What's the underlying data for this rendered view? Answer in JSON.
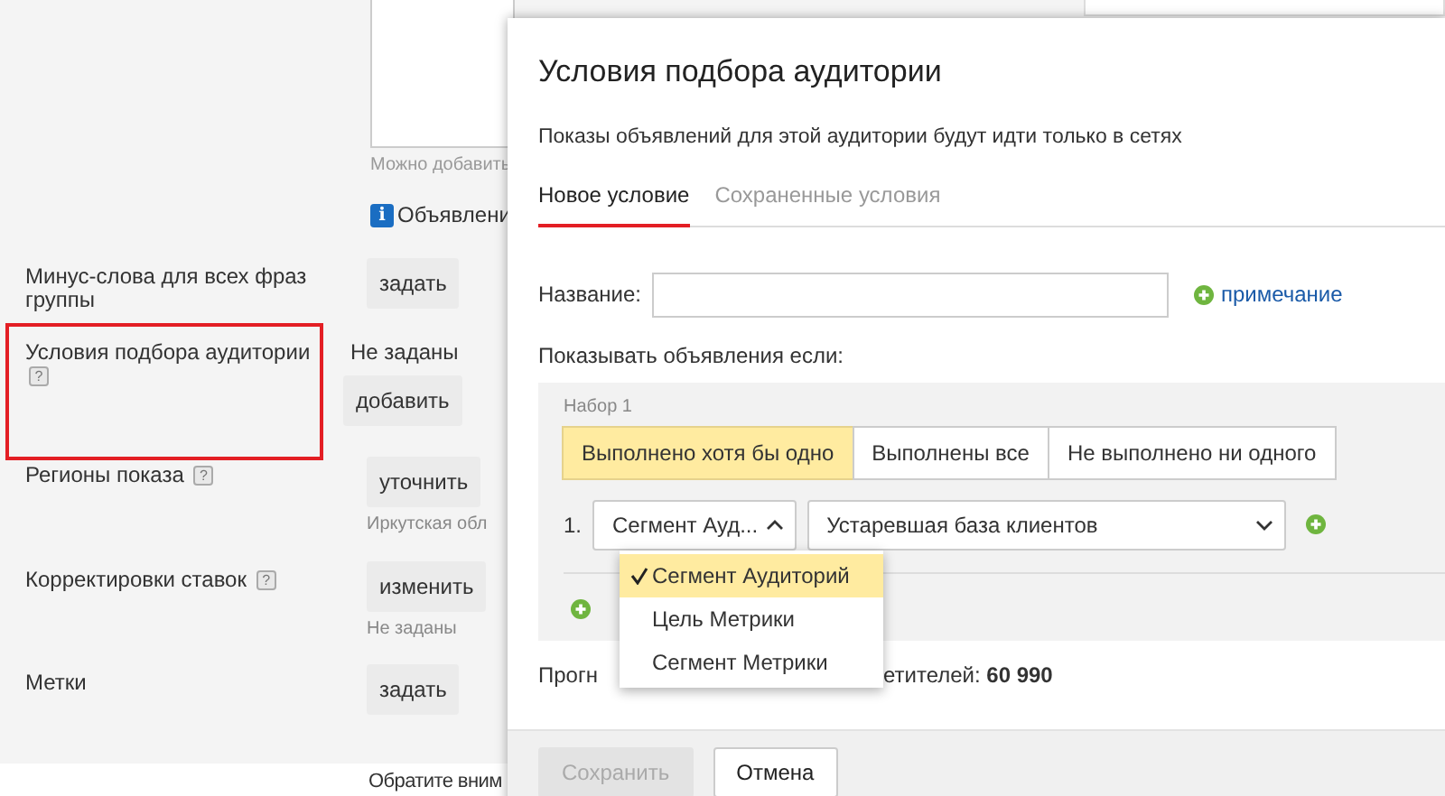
{
  "page": {
    "textarea_hint": "Можно добавить",
    "info": {
      "icon": "i",
      "text": "Объявлени"
    },
    "fields": [
      {
        "label": "Минус-слова для всех фраз группы",
        "button": "задать"
      },
      {
        "label": "Условия подбора аудитории",
        "help": "?",
        "highlighted": true,
        "value": "Не заданы",
        "button": "добавить"
      },
      {
        "label": "Регионы показа",
        "help": "?",
        "button": "уточнить",
        "note": "Иркутская обл"
      },
      {
        "label": "Корректировки ставок",
        "help": "?",
        "button": "изменить",
        "note": "Не заданы"
      },
      {
        "label": "Метки",
        "button": "задать"
      }
    ],
    "bottom_note": "Обратите вним"
  },
  "modal": {
    "title": "Условия подбора аудитории",
    "subtitle": "Показы объявлений для этой аудитории будут идти только в сетях",
    "tabs": [
      {
        "label": "Новое условие",
        "selected": true
      },
      {
        "label": "Сохраненные условия",
        "selected": false
      }
    ],
    "name_label": "Название:",
    "note_link": "примечание",
    "condition_label": "Показывать объявления если:",
    "set": {
      "title": "Набор 1",
      "modes": [
        {
          "label": "Выполнено хотя бы одно",
          "selected": true
        },
        {
          "label": "Выполнены все",
          "selected": false
        },
        {
          "label": "Не выполнено ни одного",
          "selected": false
        }
      ],
      "rules": [
        {
          "number": "1.",
          "type": "Сегмент Ауд...",
          "expanded": true,
          "value": "Устаревшая база клиентов"
        }
      ]
    },
    "dropdown": [
      {
        "label": "Сегмент Аудиторий",
        "selected": true
      },
      {
        "label": "Цель Метрики",
        "selected": false
      },
      {
        "label": "Сегмент Метрики",
        "selected": false
      }
    ],
    "forecast": {
      "before": "Прогн",
      "after": "етителей: **60 990**"
    },
    "buttons": [
      {
        "label": "Сохранить",
        "disabled": true
      },
      {
        "label": "Отмена",
        "disabled": false
      }
    ]
  }
}
